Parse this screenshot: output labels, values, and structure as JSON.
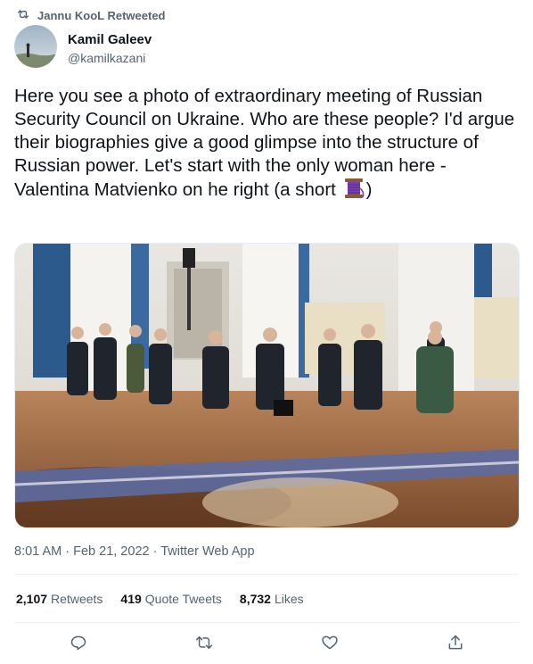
{
  "retweet_banner": {
    "text": "Jannu KooL Retweeted",
    "icon": "retweet-icon"
  },
  "author": {
    "name": "Kamil Galeev",
    "handle": "@kamilkazani"
  },
  "tweet": {
    "text": "Here you see a photo of extraordinary meeting of Russian Security Council on Ukraine. Who are these people? I'd argue their biographies give a good glimpse into the structure of Russian power. Let's start with the only woman here - Valentina Matvienko on he right (a short ",
    "text_end": ")",
    "emoji": "thread-spool-emoji"
  },
  "meta": {
    "time": "8:01 AM",
    "date": "Feb 21, 2022",
    "source": "Twitter Web App",
    "separator": "·"
  },
  "stats": {
    "retweets_count": "2,107",
    "retweets_label": "Retweets",
    "quotes_count": "419",
    "quotes_label": "Quote Tweets",
    "likes_count": "8,732",
    "likes_label": "Likes"
  },
  "actions": [
    "reply-icon",
    "retweet-icon",
    "like-icon",
    "share-icon"
  ],
  "colors": {
    "secondary_text": "#536471",
    "primary_text": "#0f1419",
    "divider": "#eff3f4"
  }
}
